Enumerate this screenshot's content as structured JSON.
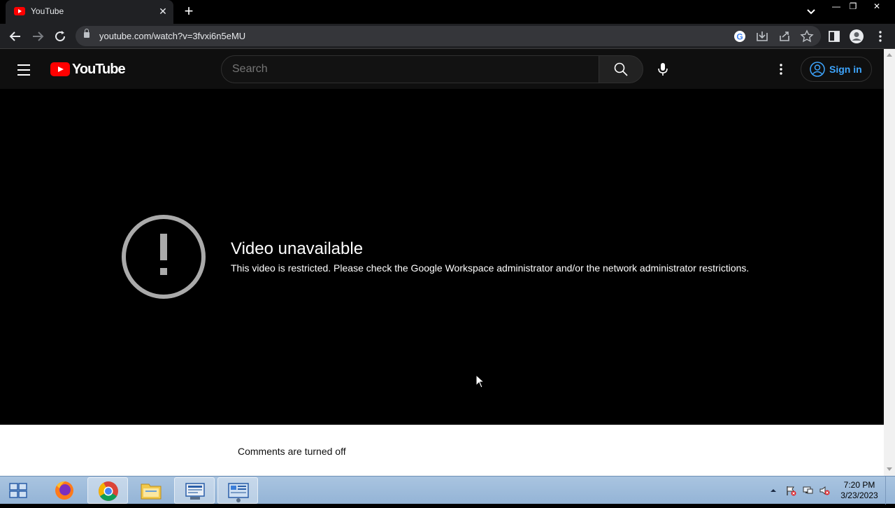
{
  "browser": {
    "tab_title": "YouTube",
    "url": "youtube.com/watch?v=3fvxi6n5eMU"
  },
  "youtube": {
    "logo_text": "YouTube",
    "search_placeholder": "Search",
    "sign_in_label": "Sign in"
  },
  "player": {
    "error_title": "Video unavailable",
    "error_message": "This video is restricted. Please check the Google Workspace administrator and/or the network administrator restrictions."
  },
  "comments": {
    "status": "Comments are turned off"
  },
  "taskbar": {
    "time": "7:20 PM",
    "date": "3/23/2023",
    "apps": [
      "firefox-icon",
      "chrome-icon",
      "file-explorer-icon",
      "network-tool-icon",
      "control-panel-icon"
    ]
  },
  "colors": {
    "youtube_red": "#ff0000",
    "link_blue": "#3ea6ff",
    "header_bg": "#0f0f0f"
  }
}
